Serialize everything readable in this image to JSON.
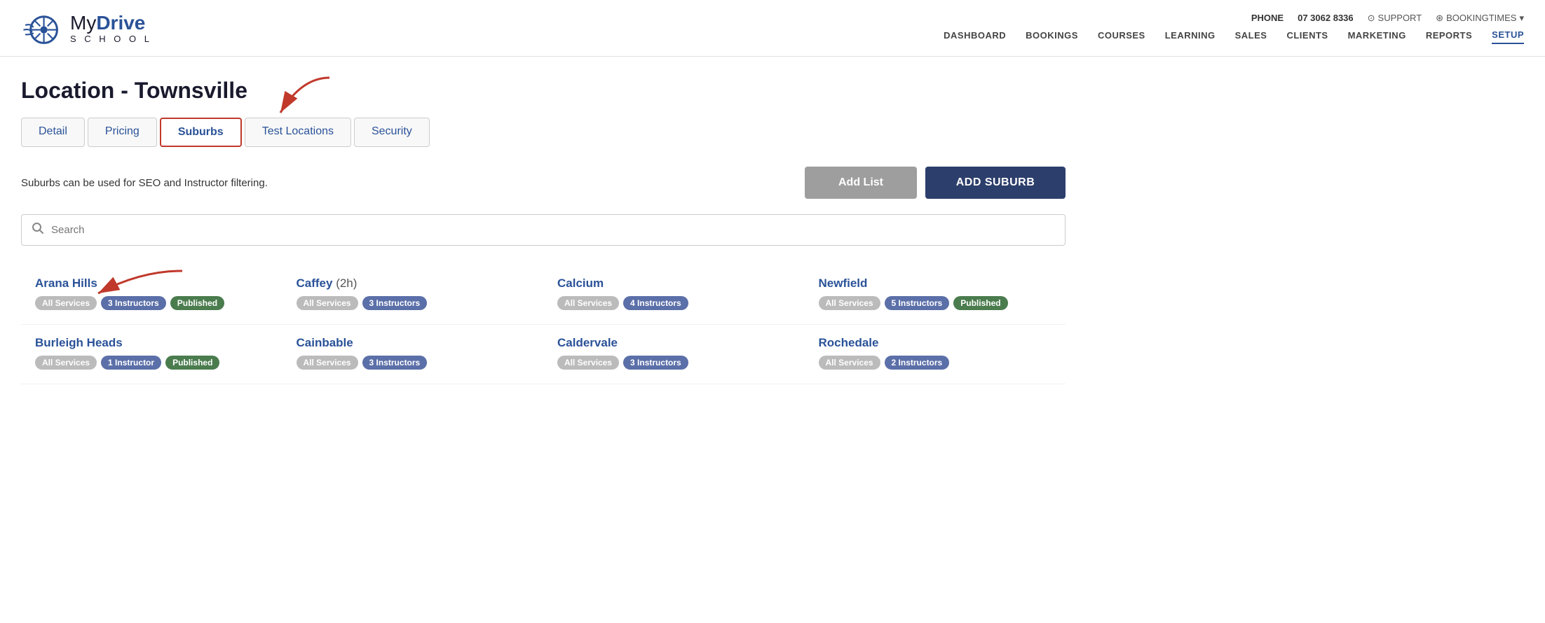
{
  "top_bar": {
    "phone_label": "PHONE",
    "phone_number": "07 3062 8336",
    "support_label": "SUPPORT",
    "booking_label": "BOOKINGTIMES"
  },
  "nav": {
    "items": [
      {
        "label": "DASHBOARD",
        "active": false
      },
      {
        "label": "BOOKINGS",
        "active": false
      },
      {
        "label": "COURSES",
        "active": false
      },
      {
        "label": "LEARNING",
        "active": false
      },
      {
        "label": "SALES",
        "active": false
      },
      {
        "label": "CLIENTS",
        "active": false
      },
      {
        "label": "MARKETING",
        "active": false
      },
      {
        "label": "REPORTS",
        "active": false
      },
      {
        "label": "SETUP",
        "active": true
      }
    ]
  },
  "page": {
    "title": "Location - Townsville",
    "description": "Suburbs can be used for SEO and Instructor filtering.",
    "btn_add_list": "Add List",
    "btn_add_suburb": "ADD SUBURB",
    "search_placeholder": "Search"
  },
  "tabs": [
    {
      "label": "Detail",
      "active": false
    },
    {
      "label": "Pricing",
      "active": false
    },
    {
      "label": "Suburbs",
      "active": true
    },
    {
      "label": "Test Locations",
      "active": false
    },
    {
      "label": "Security",
      "active": false
    }
  ],
  "suburbs": [
    {
      "name": "Arana Hills",
      "duration": "",
      "badges": [
        {
          "label": "All Services",
          "type": "services"
        },
        {
          "label": "3 Instructors",
          "type": "instructors"
        },
        {
          "label": "Published",
          "type": "published"
        }
      ]
    },
    {
      "name": "Caffey",
      "duration": "(2h)",
      "badges": [
        {
          "label": "All Services",
          "type": "services"
        },
        {
          "label": "3 Instructors",
          "type": "instructors"
        }
      ]
    },
    {
      "name": "Calcium",
      "duration": "",
      "badges": [
        {
          "label": "All Services",
          "type": "services"
        },
        {
          "label": "4 Instructors",
          "type": "instructors"
        }
      ]
    },
    {
      "name": "Newfield",
      "duration": "",
      "badges": [
        {
          "label": "All Services",
          "type": "services"
        },
        {
          "label": "5 Instructors",
          "type": "instructors"
        },
        {
          "label": "Published",
          "type": "published"
        }
      ]
    },
    {
      "name": "Burleigh Heads",
      "duration": "",
      "badges": [
        {
          "label": "All Services",
          "type": "services"
        },
        {
          "label": "1 Instructor",
          "type": "instructors"
        },
        {
          "label": "Published",
          "type": "published"
        }
      ]
    },
    {
      "name": "Cainbable",
      "duration": "",
      "badges": [
        {
          "label": "All Services",
          "type": "services"
        },
        {
          "label": "3 Instructors",
          "type": "instructors"
        }
      ]
    },
    {
      "name": "Caldervale",
      "duration": "",
      "badges": [
        {
          "label": "All Services",
          "type": "services"
        },
        {
          "label": "3 Instructors",
          "type": "instructors"
        }
      ]
    },
    {
      "name": "Rochedale",
      "duration": "",
      "badges": [
        {
          "label": "All Services",
          "type": "services"
        },
        {
          "label": "2 Instructors",
          "type": "instructors"
        }
      ]
    }
  ]
}
